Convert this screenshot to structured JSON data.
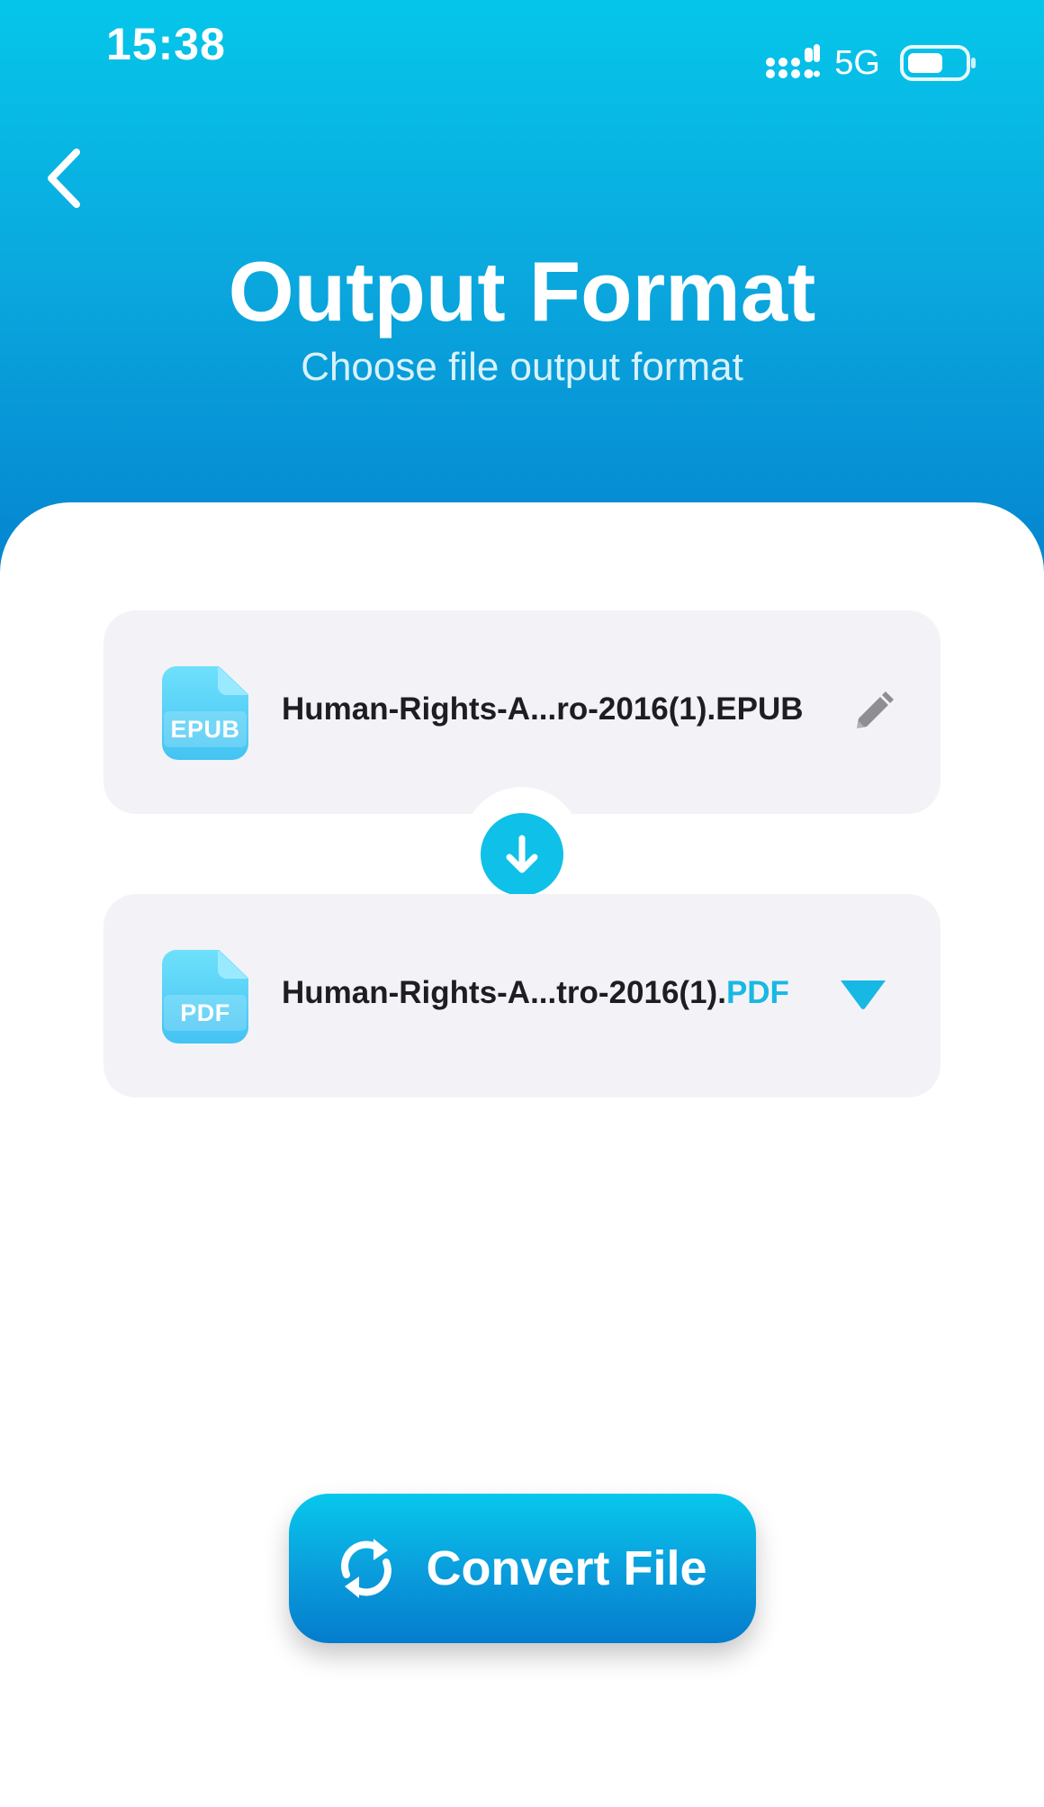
{
  "status_bar": {
    "time": "15:38",
    "network": "5G",
    "icons": [
      "signal-icon",
      "battery-icon"
    ]
  },
  "header": {
    "back_icon": "chevron-left-icon",
    "title": "Output Format",
    "subtitle": "Choose file output format"
  },
  "source_file": {
    "icon_label": "EPUB",
    "name": "Human-Rights-A...ro-2016(1).EPUB",
    "action_icon": "pencil-icon"
  },
  "connector": {
    "icon": "arrow-down-icon"
  },
  "target_file": {
    "icon_label": "PDF",
    "name_base": "Human-Rights-A...tro-2016(1).",
    "extension": "PDF",
    "action_icon": "caret-down-icon"
  },
  "convert": {
    "icon": "refresh-icon",
    "label": "Convert File"
  },
  "colors": {
    "header_top": "#05c6ea",
    "header_bottom": "#0482cf",
    "accent": "#18b8e4",
    "card_bg": "#f3f3f7",
    "text_dark": "#1e1e22"
  }
}
